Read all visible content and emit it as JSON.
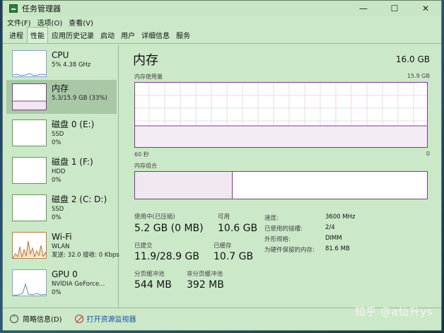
{
  "window": {
    "title": "任务管理器",
    "controls": [
      "—",
      "☐",
      "✕"
    ]
  },
  "menu": [
    "文件(F)",
    "选项(O)",
    "查看(V)"
  ],
  "tabs": [
    "进程",
    "性能",
    "应用历史记录",
    "启动",
    "用户",
    "详细信息",
    "服务"
  ],
  "active_tab": "性能",
  "sidebar": [
    {
      "title": "CPU",
      "sub1": "5% 4.38 GHz",
      "sub2": ""
    },
    {
      "title": "内存",
      "sub1": "5.3/15.9 GB (33%)",
      "sub2": ""
    },
    {
      "title": "磁盘 0 (E:)",
      "sub1": "SSD",
      "sub2": "0%"
    },
    {
      "title": "磁盘 1 (F:)",
      "sub1": "HDD",
      "sub2": "0%"
    },
    {
      "title": "磁盘 2 (C: D:)",
      "sub1": "SSD",
      "sub2": "0%"
    },
    {
      "title": "Wi-Fi",
      "sub1": "WLAN",
      "sub2": "发送: 32.0 接收: 0 Kbps"
    },
    {
      "title": "GPU 0",
      "sub1": "NVIDIA GeForce...",
      "sub2": "0%"
    }
  ],
  "main": {
    "title": "内存",
    "total": "16.0 GB",
    "usage_label": "内存使用量",
    "usage_max": "15.9 GB",
    "time_left": "60 秒",
    "time_right": "0",
    "composition_label": "内存组合",
    "in_use_label": "使用中(已压缩)",
    "in_use_value": "5.2 GB (0 MB)",
    "available_label": "可用",
    "available_value": "10.6 GB",
    "committed_label": "已提交",
    "committed_value": "11.9/28.9 GB",
    "cached_label": "已缓存",
    "cached_value": "10.7 GB",
    "paged_label": "分页缓冲池",
    "paged_value": "544 MB",
    "nonpaged_label": "非分页缓冲池",
    "nonpaged_value": "392 MB",
    "props": [
      {
        "label": "速度:",
        "value": "3600 MHz"
      },
      {
        "label": "已使用的插槽:",
        "value": "2/4"
      },
      {
        "label": "外形规格:",
        "value": "DIMM"
      },
      {
        "label": "为硬件保留的内存:",
        "value": "81.6 MB"
      }
    ],
    "usage_fraction": 0.33
  },
  "footer": {
    "brief": "简略信息(D)",
    "monitor": "打开资源监视器"
  },
  "watermark": "知乎 @a仙升ys",
  "colors": {
    "memory": "#7b3d88",
    "cpu": "#4a90c8",
    "wifi": "#b8783a"
  }
}
